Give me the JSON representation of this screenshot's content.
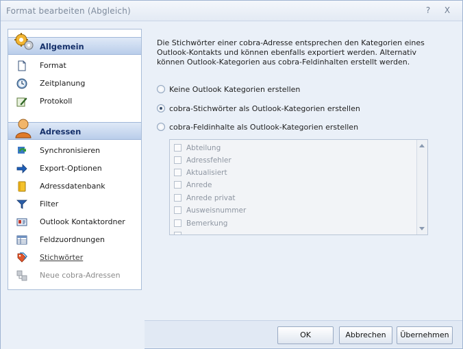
{
  "window": {
    "title": "Format bearbeiten (Abgleich)",
    "help_glyph": "?",
    "close_glyph": "X"
  },
  "sidebar": {
    "sections": [
      {
        "label": "Allgemein",
        "icon": "gears-icon",
        "items": [
          {
            "label": "Format",
            "icon": "document-icon"
          },
          {
            "label": "Zeitplanung",
            "icon": "clock-icon"
          },
          {
            "label": "Protokoll",
            "icon": "pen-icon"
          }
        ]
      },
      {
        "label": "Adressen",
        "icon": "person-icon",
        "items": [
          {
            "label": "Synchronisieren",
            "icon": "sync-icon"
          },
          {
            "label": "Export-Optionen",
            "icon": "arrow-right-icon"
          },
          {
            "label": "Adressdatenbank",
            "icon": "database-icon"
          },
          {
            "label": "Filter",
            "icon": "filter-icon"
          },
          {
            "label": "Outlook Kontaktordner",
            "icon": "contact-card-icon"
          },
          {
            "label": "Feldzuordnungen",
            "icon": "table-icon"
          },
          {
            "label": "Stichwörter",
            "icon": "tags-icon",
            "active": true
          },
          {
            "label": "Neue cobra-Adressen",
            "icon": "new-address-icon",
            "disabled": true
          }
        ]
      }
    ]
  },
  "main": {
    "description": "Die Stichwörter einer cobra-Adresse entsprechen den Kategorien eines Outlook-Kontakts und können ebenfalls exportiert werden. Alternativ können Outlook-Kategorien aus cobra-Feldinhalten erstellt werden.",
    "options": [
      {
        "label": "Keine Outlook Kategorien erstellen",
        "checked": false
      },
      {
        "label": "cobra-Stichwörter als Outlook-Kategorien erstellen",
        "checked": true
      },
      {
        "label": "cobra-Feldinhalte als Outlook-Kategorien erstellen",
        "checked": false
      }
    ],
    "field_list": {
      "items": [
        "Abteilung",
        "Adressfehler",
        "Aktualisiert",
        "Anrede",
        "Anrede privat",
        "Ausweisnummer",
        "Bemerkung"
      ],
      "enabled": false
    }
  },
  "buttons": {
    "ok": "OK",
    "cancel": "Abbrechen",
    "apply": "Übernehmen"
  },
  "colors": {
    "accent": "#15306a",
    "header_gradient_top": "#dfe9f7",
    "header_gradient_bottom": "#b9cdea",
    "dialog_bg": "#eaf0f8"
  }
}
